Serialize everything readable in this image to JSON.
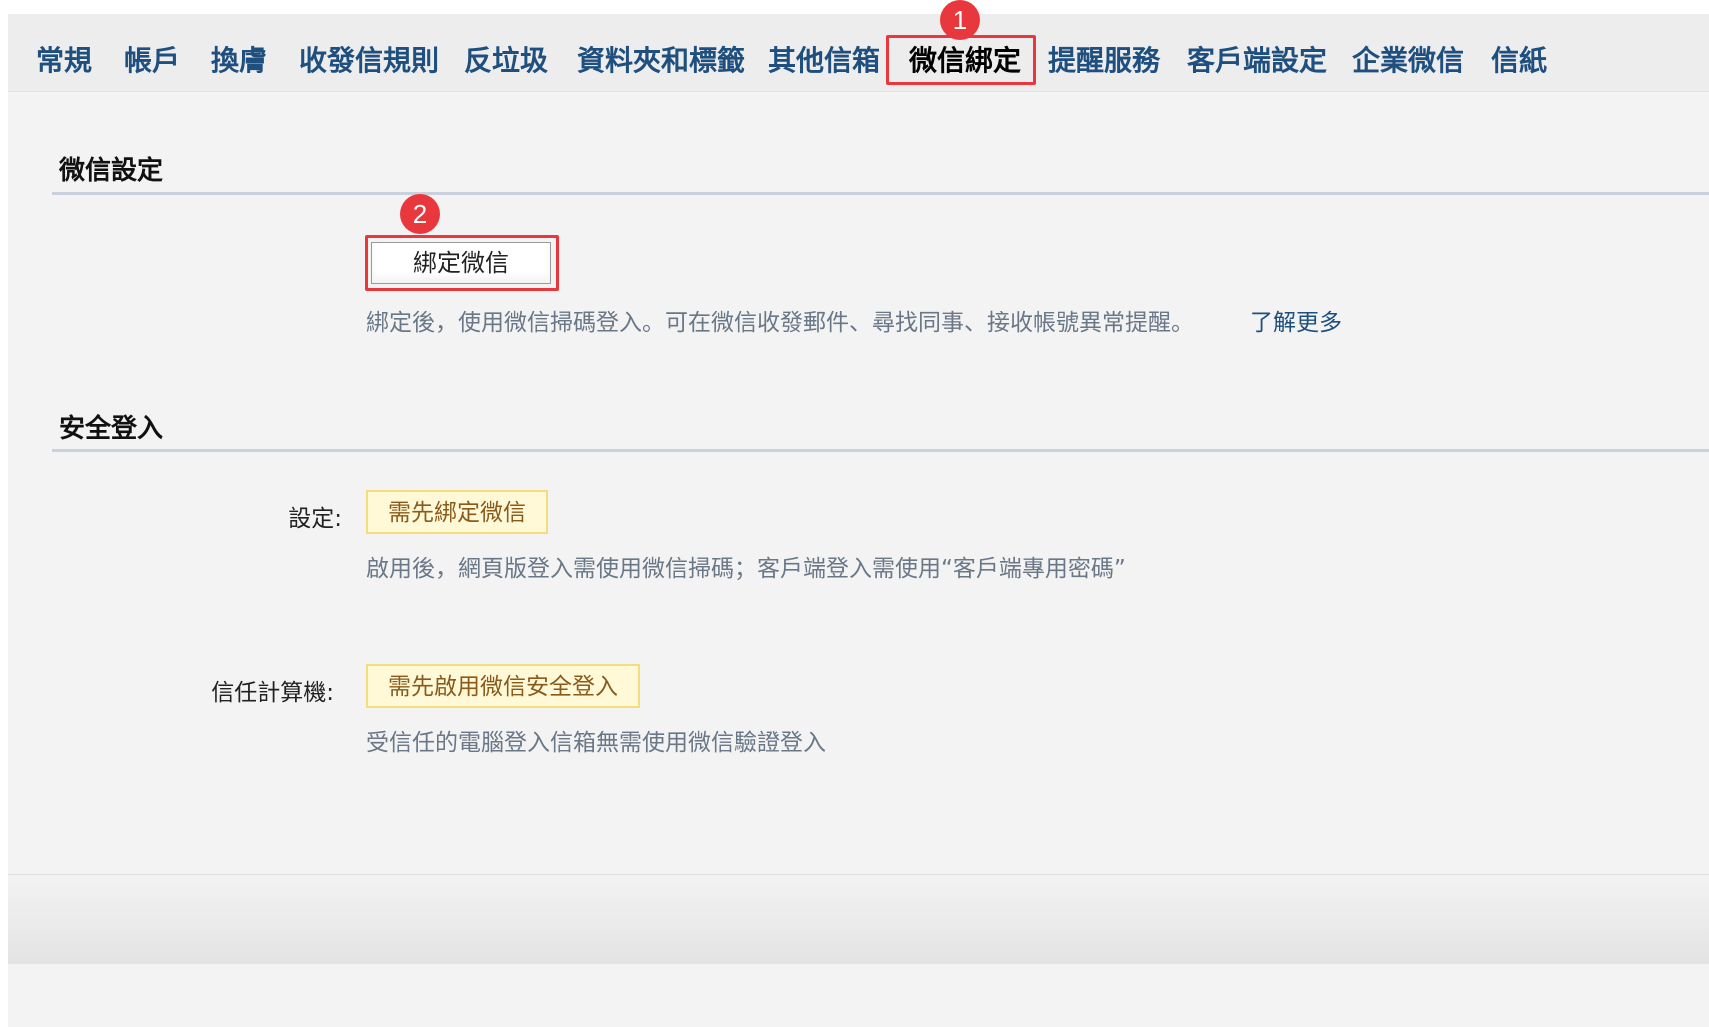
{
  "tabs": [
    {
      "label": "常規"
    },
    {
      "label": "帳戶"
    },
    {
      "label": "換膚"
    },
    {
      "label": "收發信規則"
    },
    {
      "label": "反垃圾"
    },
    {
      "label": "資料夾和標籤"
    },
    {
      "label": "其他信箱"
    },
    {
      "label": "微信綁定",
      "active": true
    },
    {
      "label": "提醒服務"
    },
    {
      "label": "客戶端設定"
    },
    {
      "label": "企業微信"
    },
    {
      "label": "信紙"
    }
  ],
  "annotations": {
    "marker1": "1",
    "marker2": "2",
    "highlight_color": "#e8383d"
  },
  "wechat_settings": {
    "title": "微信設定",
    "bind_button": "綁定微信",
    "description": "綁定後，使用微信掃碼登入。可在微信收發郵件、尋找同事、接收帳號異常提醒。",
    "learn_more": "了解更多"
  },
  "secure_login": {
    "title": "安全登入",
    "setting_label": "設定:",
    "setting_badge": "需先綁定微信",
    "setting_desc": "啟用後，網頁版登入需使用微信掃碼；客戶端登入需使用“客戶端專用密碼”",
    "trusted_label": "信任計算機:",
    "trusted_badge": "需先啟用微信安全登入",
    "trusted_desc": "受信任的電腦登入信箱無需使用微信驗證登入"
  },
  "colors": {
    "tab_text": "#1e4f7e",
    "active_tab_text": "#000000",
    "badge_bg": "#fff9d8",
    "badge_border": "#f3dd7c",
    "link": "#1e4f7e",
    "desc": "#6a7787"
  }
}
